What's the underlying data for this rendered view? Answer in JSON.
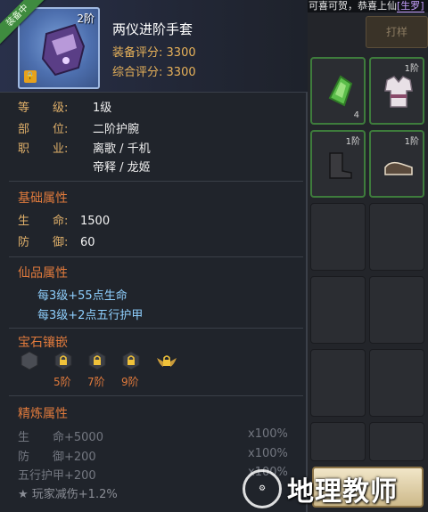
{
  "background": {
    "topbar_text": "可喜可贺，恭喜上仙",
    "topbar_highlight": "[生罗]",
    "header_button": "打样",
    "slots": [
      {
        "tier": "",
        "qty": "4",
        "kind": "gem"
      },
      {
        "tier": "1阶",
        "qty": "",
        "kind": "robe"
      },
      {
        "tier": "1阶",
        "qty": "",
        "kind": "boots-dark"
      },
      {
        "tier": "1阶",
        "qty": "",
        "kind": "shoes"
      }
    ]
  },
  "item": {
    "name": "两仪进阶手套",
    "tier_badge": "2阶",
    "equipped_label": "装备中",
    "equip_score_label": "装备评分:",
    "equip_score": "3300",
    "total_score_label": "综合评分:",
    "total_score": "3300"
  },
  "info": {
    "level_label": "等　　级:",
    "level_value": "1级",
    "part_label": "部　　位:",
    "part_value": "二阶护腕",
    "class_label": "职　　业:",
    "class_value_1": "离歌 / 千机",
    "class_value_2": "帝释 / 龙姬"
  },
  "basic": {
    "title": "基础属性",
    "rows": [
      {
        "label": "生　　命:",
        "value": "1500"
      },
      {
        "label": "防　　御:",
        "value": "60"
      }
    ]
  },
  "fairy": {
    "title": "仙品属性",
    "lines": [
      "每3级+55点生命",
      "每3级+2点五行护甲"
    ]
  },
  "gems": {
    "title": "宝石镶嵌",
    "levels": [
      "5阶",
      "7阶",
      "9阶"
    ]
  },
  "refine": {
    "title": "精炼属性",
    "rows": [
      {
        "label": "生　　命+5000",
        "pct": "x100%"
      },
      {
        "label": "防　　御+200",
        "pct": "x100%"
      },
      {
        "label": "五行护甲+200",
        "pct": "x100%"
      },
      {
        "label": "★  玩家减伤+1.2%",
        "pct": ""
      }
    ]
  },
  "watermark": {
    "text": "地理教师"
  },
  "colors": {
    "gold_label": "#e0b06a",
    "section_orange": "#e07a3c",
    "fairy_blue": "#8fd0ff",
    "equipped_green": "#3f8b3f"
  }
}
